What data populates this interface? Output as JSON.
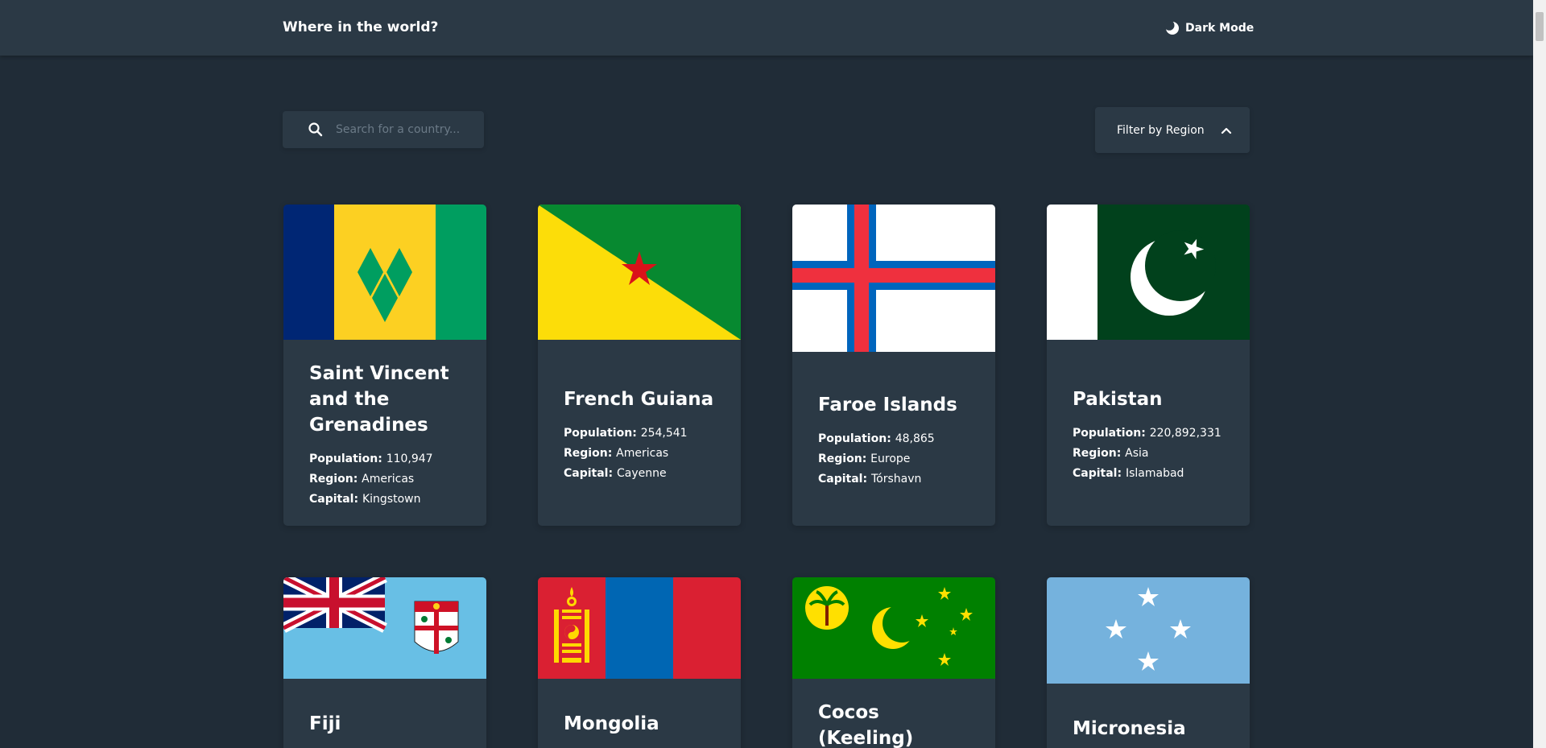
{
  "header": {
    "title": "Where in the world?",
    "dark_mode_label": "Dark Mode"
  },
  "search": {
    "placeholder": "Search for a country..."
  },
  "filter": {
    "label": "Filter by Region"
  },
  "labels": {
    "population": "Population",
    "region": "Region",
    "capital": "Capital"
  },
  "countries": [
    {
      "name": "Saint Vincent and the Grenadines",
      "population": "110,947",
      "region": "Americas",
      "capital": "Kingstown"
    },
    {
      "name": "French Guiana",
      "population": "254,541",
      "region": "Americas",
      "capital": "Cayenne"
    },
    {
      "name": "Faroe Islands",
      "population": "48,865",
      "region": "Europe",
      "capital": "Tórshavn"
    },
    {
      "name": "Pakistan",
      "population": "220,892,331",
      "region": "Asia",
      "capital": "Islamabad"
    },
    {
      "name": "Fiji"
    },
    {
      "name": "Mongolia"
    },
    {
      "name": "Cocos (Keeling) Islands"
    },
    {
      "name": "Micronesia"
    }
  ],
  "colors": {
    "background": "#202c37",
    "elements": "#2b3945",
    "text": "#ffffff"
  }
}
